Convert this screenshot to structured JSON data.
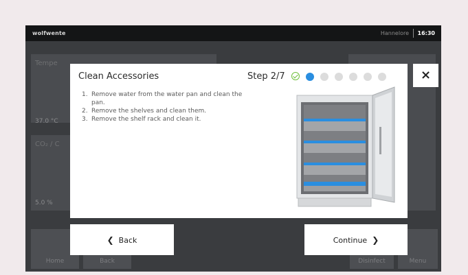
{
  "topbar": {
    "brand": "wolfwente",
    "user": "Hannelore",
    "time": "16:30"
  },
  "background": {
    "temperature_label": "Tempe",
    "temperature_value": "37.0 °C",
    "co2_label": "CO₂ / C",
    "co2_value": "5.0 %",
    "home_label": "Home",
    "back_label": "Back",
    "disinfect_label": "Disinfect",
    "menu_label": "Menu"
  },
  "dialog": {
    "title": "Clean Accessories",
    "step_label": "Step 2/7",
    "steps_total": 7,
    "steps_done": 1,
    "current_step": 2,
    "instructions": [
      {
        "num": "1.",
        "text": "Remove water from the water pan and clean the pan."
      },
      {
        "num": "2.",
        "text": "Remove the shelves and clean them."
      },
      {
        "num": "3.",
        "text": "Remove the shelf rack and clean it."
      }
    ],
    "close_icon": "×"
  },
  "buttons": {
    "back_label": "Back",
    "continue_label": "Continue"
  },
  "colors": {
    "accent_blue": "#2a8ee0",
    "done_green": "#6fbf3b",
    "dot_inactive": "#dcdcdc",
    "shelf_highlight": "#2a8ee0"
  },
  "icons": {
    "close": "close-icon",
    "back": "chevron-left-icon",
    "continue": "chevron-right-icon",
    "done_step": "check-circle-icon",
    "illustration": "incubator-illustration"
  }
}
